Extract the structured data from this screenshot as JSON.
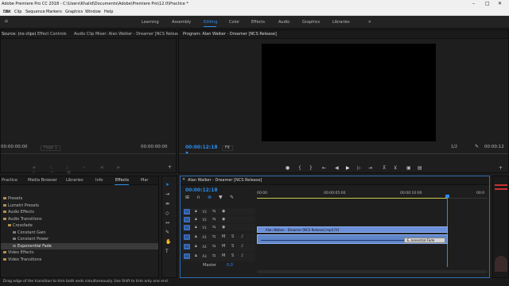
{
  "app": {
    "title": "Adobe Premiere Pro CC 2018 - C:\\Users\\Khalid\\Documents\\Adobe\\Premiere Pro\\12.0\\Practice *"
  },
  "menu": [
    "File",
    "Edit",
    "Clip",
    "Sequence",
    "Markers",
    "Graphics",
    "Window",
    "Help"
  ],
  "workspaces": {
    "tabs": [
      "Learning",
      "Assembly",
      "Editing",
      "Color",
      "Effects",
      "Audio",
      "Graphics",
      "Libraries"
    ],
    "active": "Editing",
    "more": "»"
  },
  "source_panel": {
    "tabs": [
      "Source: (no clips)",
      "Effect Controls",
      "Audio Clip Mixer: Alan Walker - Dreamer [NCS Release]"
    ],
    "timecode_left": "00:00:00:00",
    "timecode_right": "00:00:00:00",
    "page": "Page 1"
  },
  "program_panel": {
    "tab": "Program: Alan Walker - Dreamer [NCS Release]",
    "timecode": "00:00:12:18",
    "fit": "Fit",
    "resolution": "1/2",
    "duration": "00:00:12"
  },
  "project_panel": {
    "tabs": [
      "Practice",
      "Media Browser",
      "Libraries",
      "Info",
      "Effects",
      "Mar"
    ],
    "active": "Effects",
    "items": [
      {
        "label": "Presets",
        "level": 0,
        "selected": false
      },
      {
        "label": "Lumetri Presets",
        "level": 0,
        "selected": false
      },
      {
        "label": "Audio Effects",
        "level": 0,
        "selected": false
      },
      {
        "label": "Audio Transitions",
        "level": 0,
        "selected": false
      },
      {
        "label": "Crossfade",
        "level": 1,
        "selected": false
      },
      {
        "label": "Constant Gain",
        "level": 2,
        "selected": false
      },
      {
        "label": "Constant Power",
        "level": 2,
        "selected": false
      },
      {
        "label": "Exponential Fade",
        "level": 2,
        "selected": true
      },
      {
        "label": "Video Effects",
        "level": 0,
        "selected": false
      },
      {
        "label": "Video Transitions",
        "level": 0,
        "selected": false
      }
    ]
  },
  "timeline": {
    "tab": "Alan Walker - Dreamer [NCS Release]",
    "timecode": "00:00:12:18",
    "ruler": [
      "00:00",
      "00:00:05:00",
      "00:00:10:00",
      "00:0"
    ],
    "video_tracks": [
      "V3",
      "V2",
      "V1"
    ],
    "audio_tracks": [
      "A1",
      "A2",
      "A3"
    ],
    "master_label": "Master",
    "master_value": "0.0",
    "video_clip": "Alan Walker - Dreamer [NCS Release].mp4 [V]",
    "transition_label": "Exponential Fade"
  },
  "status": {
    "text": "Drag edge of the transition to trim both ends simultaneously. Use Shift to trim only one end."
  },
  "colors": {
    "accent": "#2d8ceb",
    "video_clip": "#6b8fd8",
    "audio_clip": "#5f86c8",
    "track_on": "#3a6fc4"
  }
}
